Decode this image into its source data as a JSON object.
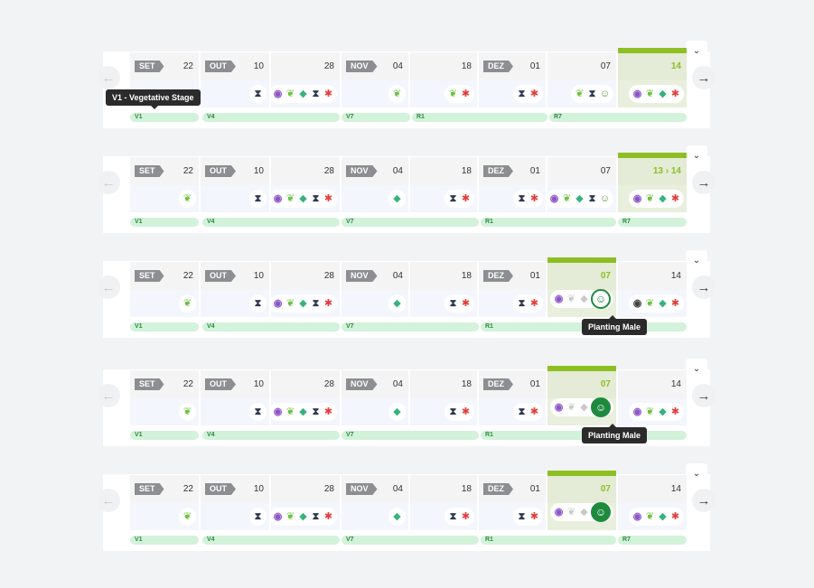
{
  "panels": [
    {
      "months": [
        "SET",
        "OUT",
        "NOV",
        "DEZ"
      ],
      "days": [
        "22",
        "10",
        "28",
        "04",
        "18",
        "01",
        "07",
        "14"
      ],
      "stages": [
        "V1",
        "V4",
        "V7",
        "R1",
        "R7"
      ],
      "highlight_day": "14",
      "tooltip": "V1 - Vegetative Stage"
    },
    {
      "months": [
        "SET",
        "OUT",
        "NOV",
        "DEZ"
      ],
      "days": [
        "22",
        "10",
        "28",
        "04",
        "18",
        "01",
        "07",
        "13 › 14"
      ],
      "stages": [
        "V1",
        "V4",
        "V7",
        "R1",
        "R7"
      ],
      "highlight_day": "13 › 14"
    },
    {
      "months": [
        "SET",
        "OUT",
        "NOV",
        "DEZ"
      ],
      "days": [
        "22",
        "10",
        "28",
        "04",
        "18",
        "01",
        "07",
        "14"
      ],
      "stages": [
        "V1",
        "V4",
        "V7",
        "R1"
      ],
      "highlight_day": "07",
      "tooltip": "Planting Male"
    },
    {
      "months": [
        "SET",
        "OUT",
        "NOV",
        "DEZ"
      ],
      "days": [
        "22",
        "10",
        "28",
        "04",
        "18",
        "01",
        "07",
        "14"
      ],
      "stages": [
        "V1",
        "V4",
        "V7",
        "R1"
      ],
      "highlight_day": "07",
      "tooltip": "Planting Male"
    },
    {
      "months": [
        "SET",
        "OUT",
        "NOV",
        "DEZ"
      ],
      "days": [
        "22",
        "10",
        "28",
        "04",
        "18",
        "01",
        "07",
        "14"
      ],
      "stages": [
        "V1",
        "V4",
        "V7",
        "R1",
        "R7"
      ],
      "highlight_day": "07"
    }
  ],
  "icons": {
    "chevron": "⌄",
    "arrow_left": "←",
    "arrow_right": "→",
    "stage": "⧗",
    "balloon": "◉",
    "sprout": "❦",
    "drop": "◆",
    "flask": "⧗",
    "bug": "✱",
    "planting": "☺"
  },
  "colors": {
    "accent": "#8dbf24",
    "stage_bar": "#d2f2d9",
    "month_chip": "#8c8e91",
    "bug": "#e23d3d",
    "sprout": "#6bbf3c",
    "balloon": "#8e55c9",
    "planting": "#1e8a3e"
  }
}
